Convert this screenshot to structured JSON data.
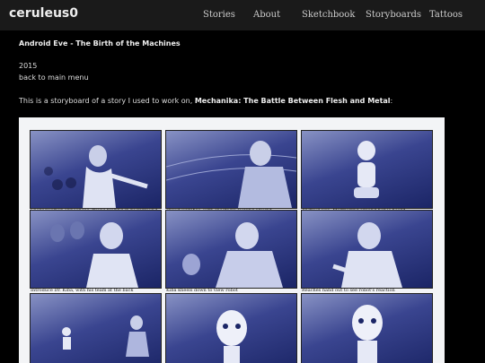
{
  "header": {
    "logo": "ceruleus0",
    "nav": [
      "Stories",
      "About",
      "Sketchbook",
      "Storyboards",
      "Tattoos"
    ]
  },
  "page": {
    "title": "Android Eve - The Birth of the Machines",
    "year": "2015",
    "back_link": "back to main menu",
    "intro_prefix": "This is a storyboard of a story I used to work on, ",
    "intro_bold": "Mechanika: The Battle Between Flesh and Metal",
    "intro_suffix": ":"
  },
  "storyboard": {
    "captions": [
      "Spokeswoman announces, music blaring in background",
      "crowd watches, with spectacle looking around.",
      "Android Eve. Murmuring around her is heard.",
      "Introduce Dr. Kiba, with his team at the back",
      "Kiba kneels down to view robot",
      "Reaches hand out to see robot's reaction"
    ]
  },
  "colors": {
    "background": "#000000",
    "topbar": "#1a1a1a",
    "panel_dark": "#1b2566",
    "panel_light": "#8892c4"
  }
}
